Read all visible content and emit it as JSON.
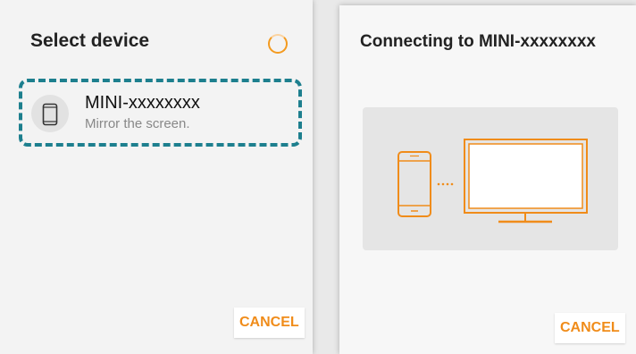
{
  "select_dialog": {
    "title": "Select device",
    "device": {
      "name": "MINI-xxxxxxxx",
      "description": "Mirror the screen."
    },
    "cancel_label": "CANCEL"
  },
  "connect_dialog": {
    "title": "Connecting to MINI-xxxxxxxx",
    "cancel_label": "CANCEL"
  },
  "icons": {
    "device": "phone-icon",
    "spinner": "loading-spinner-icon",
    "illustration_phone": "phone-icon",
    "illustration_dots": "ellipsis-icon",
    "illustration_tv": "monitor-icon"
  },
  "colors": {
    "accent": "#f08c1a",
    "highlight_border": "#1d7f8e",
    "panel_bg": "#f3f3f3"
  }
}
